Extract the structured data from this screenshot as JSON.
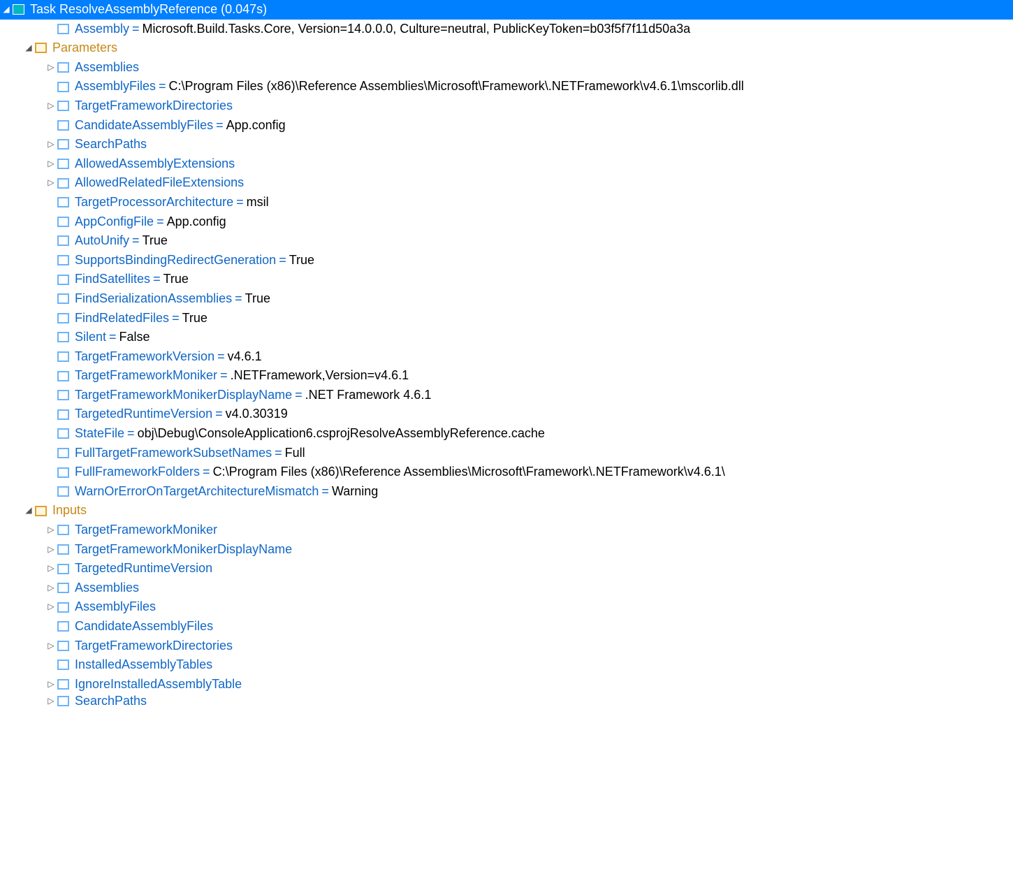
{
  "tree": [
    {
      "depth": 0,
      "glyph": "down",
      "icon": "task",
      "key": "Task ResolveAssemblyReference (0.047s)",
      "value": null,
      "selected": true,
      "keyColor": "white"
    },
    {
      "depth": 2,
      "glyph": "none",
      "icon": "param",
      "key": "Assembly",
      "value": "Microsoft.Build.Tasks.Core, Version=14.0.0.0, Culture=neutral, PublicKeyToken=b03f5f7f11d50a3a"
    },
    {
      "depth": 1,
      "glyph": "down",
      "icon": "folder",
      "key": "Parameters",
      "value": null,
      "keyColor": "folder"
    },
    {
      "depth": 2,
      "glyph": "right",
      "icon": "param",
      "key": "Assemblies",
      "value": null
    },
    {
      "depth": 2,
      "glyph": "none",
      "icon": "param",
      "key": "AssemblyFiles",
      "value": "C:\\Program Files (x86)\\Reference Assemblies\\Microsoft\\Framework\\.NETFramework\\v4.6.1\\mscorlib.dll"
    },
    {
      "depth": 2,
      "glyph": "right",
      "icon": "param",
      "key": "TargetFrameworkDirectories",
      "value": null
    },
    {
      "depth": 2,
      "glyph": "none",
      "icon": "param",
      "key": "CandidateAssemblyFiles",
      "value": "App.config"
    },
    {
      "depth": 2,
      "glyph": "right",
      "icon": "param",
      "key": "SearchPaths",
      "value": null
    },
    {
      "depth": 2,
      "glyph": "right",
      "icon": "param",
      "key": "AllowedAssemblyExtensions",
      "value": null
    },
    {
      "depth": 2,
      "glyph": "right",
      "icon": "param",
      "key": "AllowedRelatedFileExtensions",
      "value": null
    },
    {
      "depth": 2,
      "glyph": "none",
      "icon": "param",
      "key": "TargetProcessorArchitecture",
      "value": "msil"
    },
    {
      "depth": 2,
      "glyph": "none",
      "icon": "param",
      "key": "AppConfigFile",
      "value": "App.config"
    },
    {
      "depth": 2,
      "glyph": "none",
      "icon": "param",
      "key": "AutoUnify",
      "value": "True"
    },
    {
      "depth": 2,
      "glyph": "none",
      "icon": "param",
      "key": "SupportsBindingRedirectGeneration",
      "value": "True"
    },
    {
      "depth": 2,
      "glyph": "none",
      "icon": "param",
      "key": "FindSatellites",
      "value": "True"
    },
    {
      "depth": 2,
      "glyph": "none",
      "icon": "param",
      "key": "FindSerializationAssemblies",
      "value": "True"
    },
    {
      "depth": 2,
      "glyph": "none",
      "icon": "param",
      "key": "FindRelatedFiles",
      "value": "True"
    },
    {
      "depth": 2,
      "glyph": "none",
      "icon": "param",
      "key": "Silent",
      "value": "False"
    },
    {
      "depth": 2,
      "glyph": "none",
      "icon": "param",
      "key": "TargetFrameworkVersion",
      "value": "v4.6.1"
    },
    {
      "depth": 2,
      "glyph": "none",
      "icon": "param",
      "key": "TargetFrameworkMoniker",
      "value": ".NETFramework,Version=v4.6.1"
    },
    {
      "depth": 2,
      "glyph": "none",
      "icon": "param",
      "key": "TargetFrameworkMonikerDisplayName",
      "value": ".NET Framework 4.6.1"
    },
    {
      "depth": 2,
      "glyph": "none",
      "icon": "param",
      "key": "TargetedRuntimeVersion",
      "value": "v4.0.30319"
    },
    {
      "depth": 2,
      "glyph": "none",
      "icon": "param",
      "key": "StateFile",
      "value": "obj\\Debug\\ConsoleApplication6.csprojResolveAssemblyReference.cache"
    },
    {
      "depth": 2,
      "glyph": "none",
      "icon": "param",
      "key": "FullTargetFrameworkSubsetNames",
      "value": "Full"
    },
    {
      "depth": 2,
      "glyph": "none",
      "icon": "param",
      "key": "FullFrameworkFolders",
      "value": "C:\\Program Files (x86)\\Reference Assemblies\\Microsoft\\Framework\\.NETFramework\\v4.6.1\\"
    },
    {
      "depth": 2,
      "glyph": "none",
      "icon": "param",
      "key": "WarnOrErrorOnTargetArchitectureMismatch",
      "value": "Warning"
    },
    {
      "depth": 1,
      "glyph": "down",
      "icon": "folder",
      "key": "Inputs",
      "value": null,
      "keyColor": "folder"
    },
    {
      "depth": 2,
      "glyph": "right",
      "icon": "param",
      "key": "TargetFrameworkMoniker",
      "value": null
    },
    {
      "depth": 2,
      "glyph": "right",
      "icon": "param",
      "key": "TargetFrameworkMonikerDisplayName",
      "value": null
    },
    {
      "depth": 2,
      "glyph": "right",
      "icon": "param",
      "key": "TargetedRuntimeVersion",
      "value": null
    },
    {
      "depth": 2,
      "glyph": "right",
      "icon": "param",
      "key": "Assemblies",
      "value": null
    },
    {
      "depth": 2,
      "glyph": "right",
      "icon": "param",
      "key": "AssemblyFiles",
      "value": null
    },
    {
      "depth": 2,
      "glyph": "none",
      "icon": "param",
      "key": "CandidateAssemblyFiles",
      "value": null
    },
    {
      "depth": 2,
      "glyph": "right",
      "icon": "param",
      "key": "TargetFrameworkDirectories",
      "value": null
    },
    {
      "depth": 2,
      "glyph": "none",
      "icon": "param",
      "key": "InstalledAssemblyTables",
      "value": null
    },
    {
      "depth": 2,
      "glyph": "right",
      "icon": "param",
      "key": "IgnoreInstalledAssemblyTable",
      "value": null
    },
    {
      "depth": 2,
      "glyph": "right",
      "icon": "param",
      "key": "SearchPaths",
      "value": null,
      "cut": true
    }
  ],
  "glyphs": {
    "down": "◢",
    "right": "▷",
    "none": "▷"
  }
}
